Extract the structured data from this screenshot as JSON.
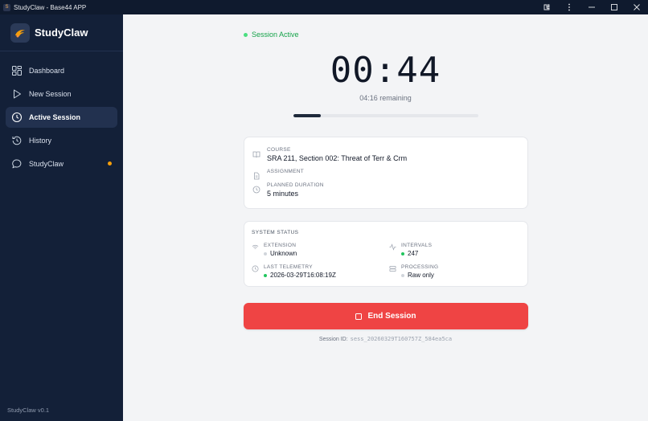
{
  "window": {
    "title": "StudyClaw - Base44 APP"
  },
  "sidebar": {
    "brand": "StudyClaw",
    "items": [
      {
        "label": "Dashboard",
        "icon": "grid-icon",
        "active": false
      },
      {
        "label": "New Session",
        "icon": "play-icon",
        "active": false
      },
      {
        "label": "Active Session",
        "icon": "clock-icon",
        "active": true
      },
      {
        "label": "History",
        "icon": "history-icon",
        "active": false
      },
      {
        "label": "StudyClaw",
        "icon": "chat-icon",
        "active": false,
        "badge_color": "#f59e0b"
      }
    ],
    "version": "StudyClaw v0.1"
  },
  "session": {
    "status": "Session Active",
    "timer": "00:44",
    "remaining": "04:16 remaining",
    "progress_fraction": 0.147
  },
  "details": {
    "course_label": "COURSE",
    "course_value": "SRA 211, Section 002: Threat of Terr & Crm",
    "assignment_label": "ASSIGNMENT",
    "duration_label": "PLANNED DURATION",
    "duration_value": "5 minutes"
  },
  "system": {
    "title": "SYSTEM STATUS",
    "extension_label": "EXTENSION",
    "extension_value": "Unknown",
    "intervals_label": "INTERVALS",
    "intervals_value": "247",
    "telemetry_label": "LAST TELEMETRY",
    "telemetry_value": "2026-03-29T16:08:19Z",
    "processing_label": "PROCESSING",
    "processing_value": "Raw only"
  },
  "actions": {
    "end_label": "End Session"
  },
  "footer": {
    "session_id_label": "Session ID:",
    "session_id_value": "sess_20260329T160757Z_584ea5ca"
  },
  "colors": {
    "sidebar_bg": "#132038",
    "accent_red": "#ef4444",
    "active_green": "#4ade80",
    "badge_orange": "#f59e0b"
  }
}
